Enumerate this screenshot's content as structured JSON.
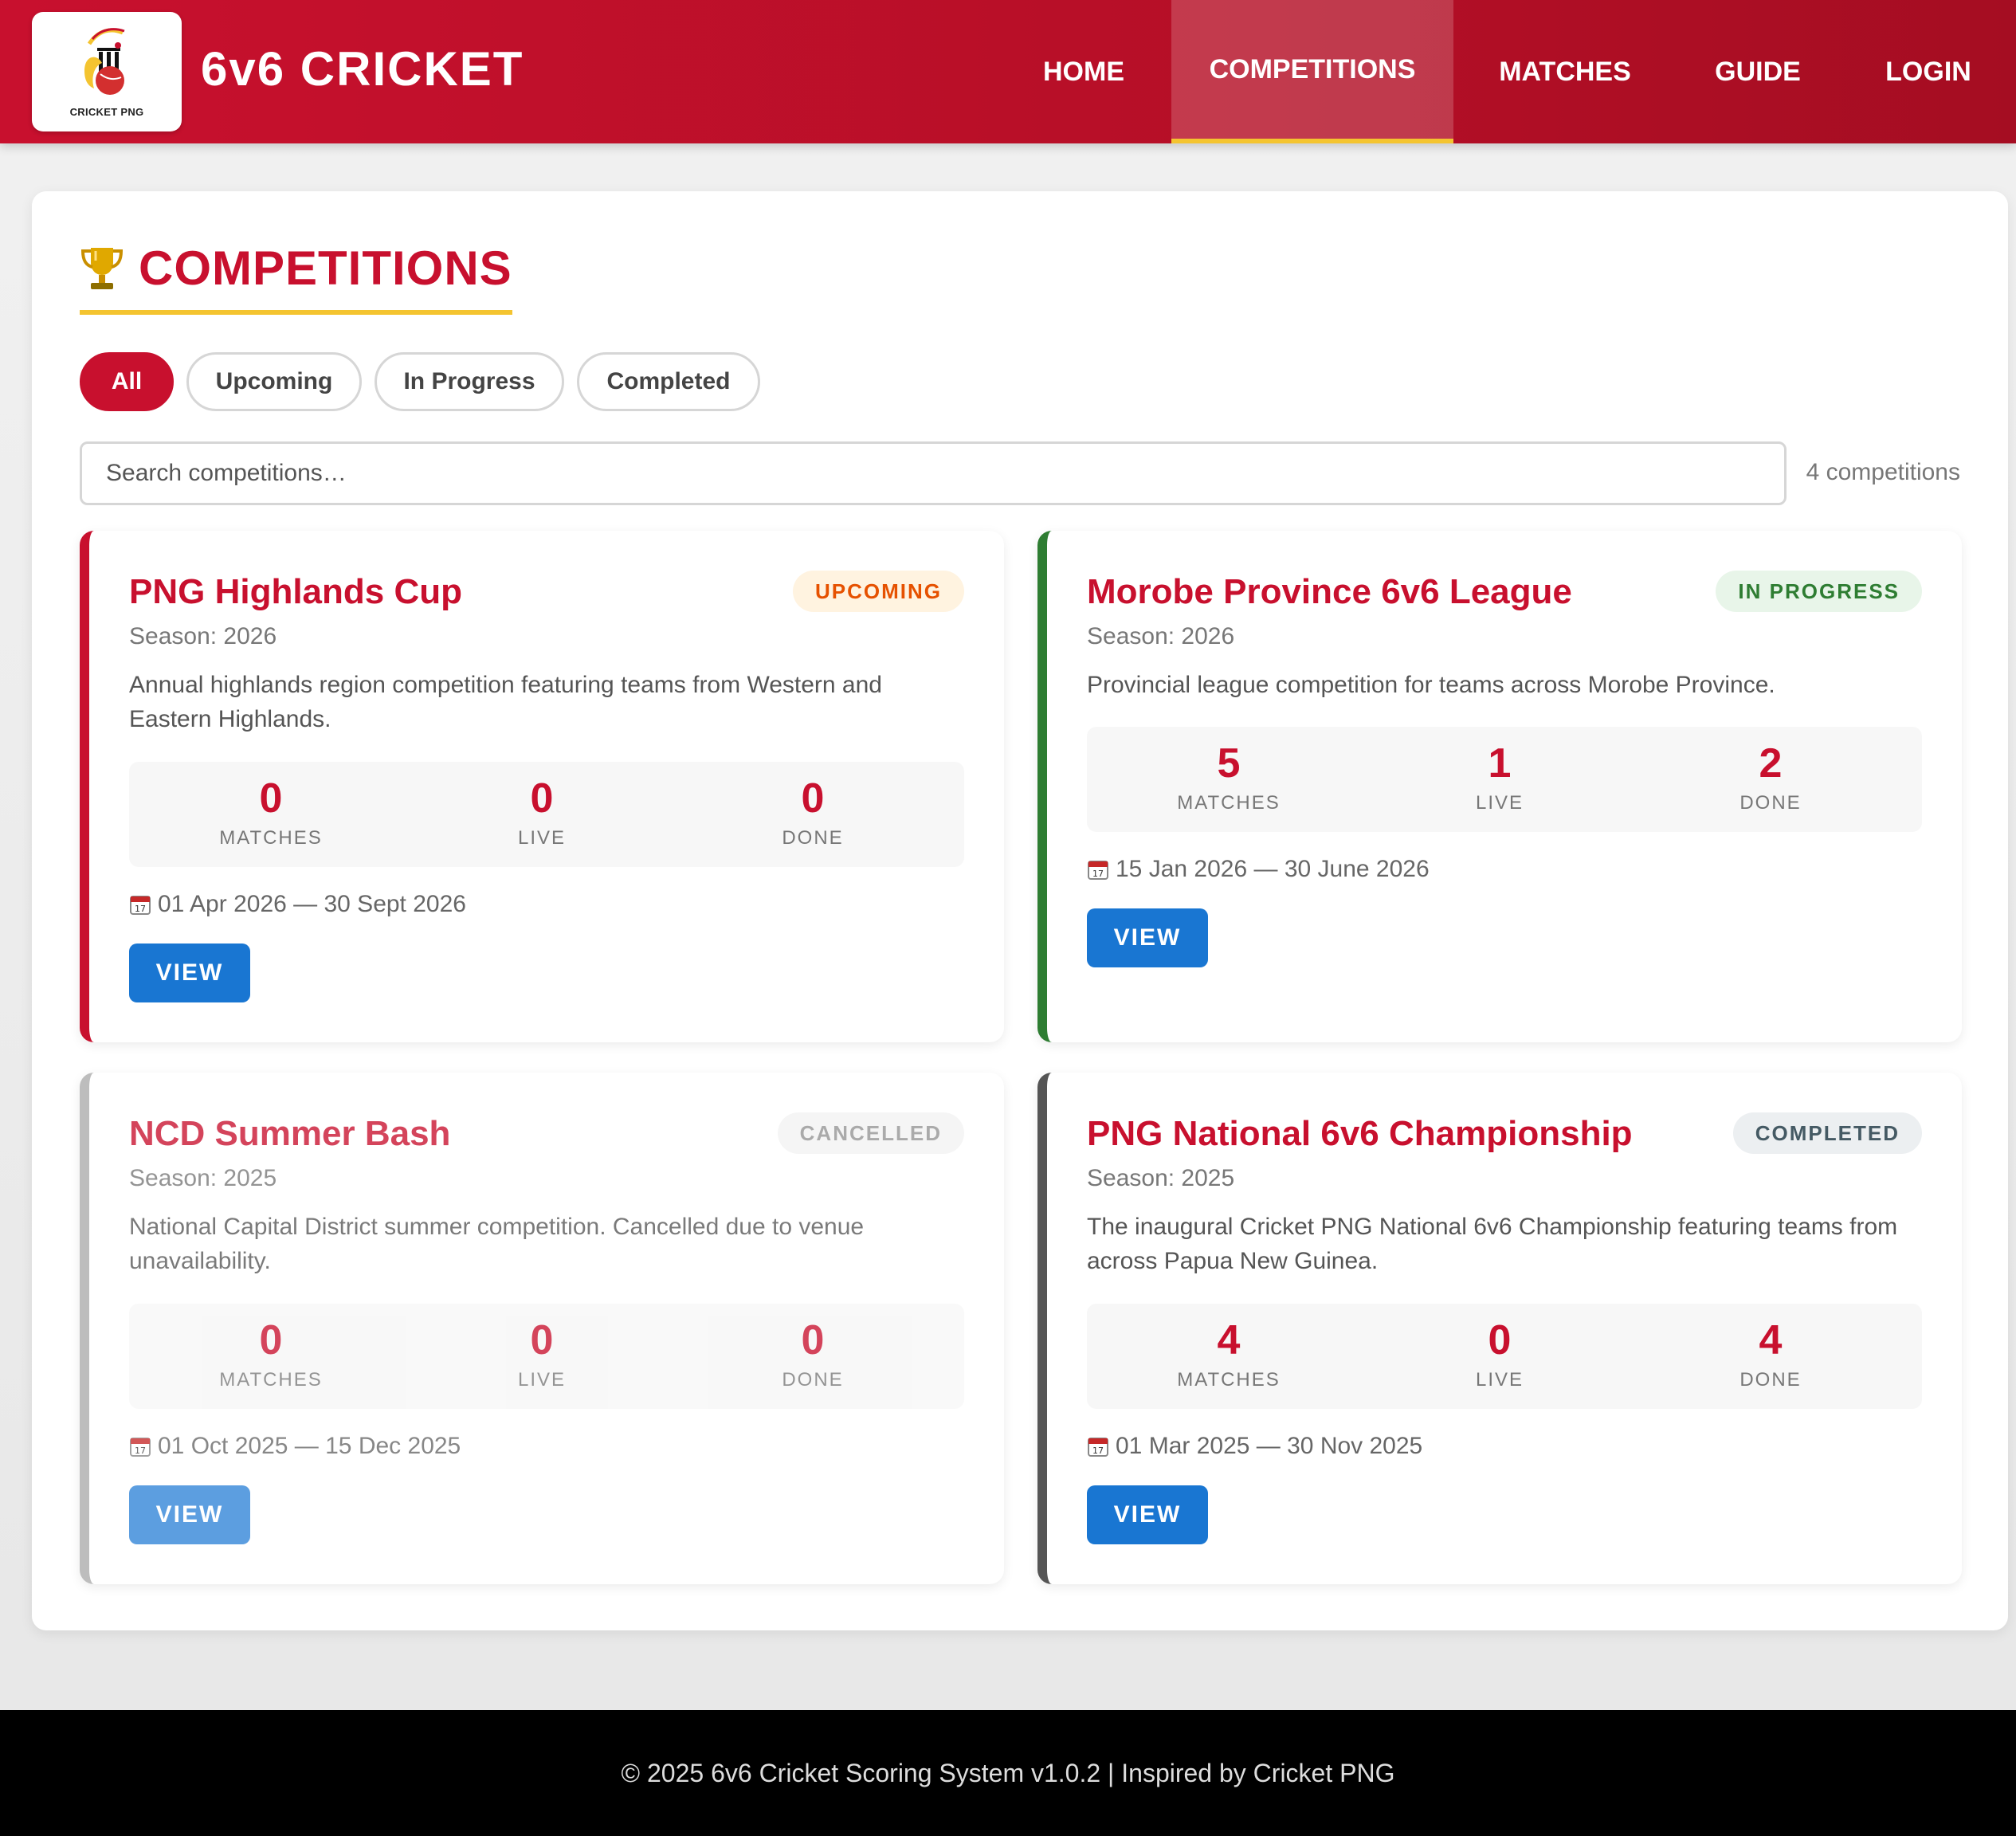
{
  "app": {
    "logo_text": "CRICKET PNG",
    "brand": "6v6 CRICKET"
  },
  "nav": {
    "items": [
      {
        "label": "HOME"
      },
      {
        "label": "COMPETITIONS",
        "active": true
      },
      {
        "label": "MATCHES"
      },
      {
        "label": "GUIDE"
      },
      {
        "label": "LOGIN"
      }
    ]
  },
  "page": {
    "title": "COMPETITIONS",
    "title_icon": "trophy-icon",
    "filters": [
      "All",
      "Upcoming",
      "In Progress",
      "Completed"
    ],
    "active_filter": "All",
    "search_placeholder": "Search competitions…",
    "search_value": "",
    "count_text": "4 competitions"
  },
  "competitions": [
    {
      "name": "PNG Highlands Cup",
      "status": "UPCOMING",
      "season": "Season: 2026",
      "description": "Annual highlands region competition featuring teams from Western and Eastern Highlands.",
      "stats": {
        "matches": "0",
        "live": "0",
        "done": "0"
      },
      "dates": "01 Apr 2026 — 30 Sept 2026",
      "view_label": "VIEW",
      "accent": "#c8102e"
    },
    {
      "name": "Morobe Province 6v6 League",
      "status": "IN PROGRESS",
      "season": "Season: 2026",
      "description": "Provincial league competition for teams across Morobe Province.",
      "stats": {
        "matches": "5",
        "live": "1",
        "done": "2"
      },
      "dates": "15 Jan 2026 — 30 June 2026",
      "view_label": "VIEW",
      "accent": "#2e7d32"
    },
    {
      "name": "NCD Summer Bash",
      "status": "CANCELLED",
      "season": "Season: 2025",
      "description": "National Capital District summer competition. Cancelled due to venue unavailability.",
      "stats": {
        "matches": "0",
        "live": "0",
        "done": "0"
      },
      "dates": "01 Oct 2025 — 15 Dec 2025",
      "view_label": "VIEW",
      "accent": "#bdbdbd"
    },
    {
      "name": "PNG National 6v6 Championship",
      "status": "COMPLETED",
      "season": "Season: 2025",
      "description": "The inaugural Cricket PNG National 6v6 Championship featuring teams from across Papua New Guinea.",
      "stats": {
        "matches": "4",
        "live": "0",
        "done": "4"
      },
      "dates": "01 Mar 2025 — 30 Nov 2025",
      "view_label": "VIEW",
      "accent": "#555555"
    }
  ],
  "stat_labels": {
    "matches": "MATCHES",
    "live": "LIVE",
    "done": "DONE"
  },
  "footer": {
    "text": "© 2025 6v6 Cricket Scoring System v1.0.2 | Inspired by Cricket PNG"
  },
  "colors": {
    "brand_red": "#c8102e",
    "accent_yellow": "#f4c430",
    "button_blue": "#1976d2"
  }
}
